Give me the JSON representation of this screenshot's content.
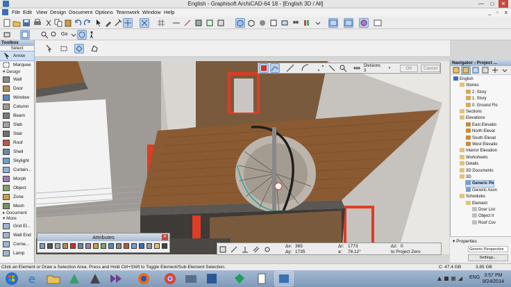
{
  "window": {
    "title": "English - Graphisoft ArchiCAD-64 18 - [English 3D / All]",
    "minimize_glyph": "—",
    "maximize_glyph": "□",
    "close_glyph": "✕",
    "mdi_min": "_",
    "mdi_restore": "▫",
    "mdi_close": "x"
  },
  "menu": [
    "File",
    "Edit",
    "View",
    "Design",
    "Document",
    "Options",
    "Teamwork",
    "Window",
    "Help"
  ],
  "toolbar": {
    "go_label": "Go"
  },
  "toolbox": {
    "title": "Toolbox",
    "select_section": "Select",
    "select_tools": [
      "Arrow",
      "Marquee"
    ],
    "design_section": "Design",
    "design_tools": [
      "Wall",
      "Door",
      "Window",
      "Column",
      "Beam",
      "Slab",
      "Stair",
      "Roof",
      "Shell",
      "Skylight",
      "Curtain...",
      "Morph",
      "Object",
      "Zone",
      "Mesh"
    ],
    "document_section": "Document",
    "more_section": "More",
    "more_tools": [
      "Grid El...",
      "Wall End",
      "Corne...",
      "Lamp"
    ]
  },
  "infobox": {
    "divisions_label": "Divisions",
    "divisions_value": "3",
    "ok_label": "OK",
    "cancel_label": "Cancel"
  },
  "navigator": {
    "title": "Navigator - Project ...",
    "tree": [
      {
        "label": "English",
        "depth": 0,
        "icon": "project-icon"
      },
      {
        "label": "Stories",
        "depth": 1,
        "icon": "folder-icon"
      },
      {
        "label": "2. Story",
        "depth": 2,
        "icon": "story-icon"
      },
      {
        "label": "1. Story",
        "depth": 2,
        "icon": "story-icon"
      },
      {
        "label": "0. Ground Flo",
        "depth": 2,
        "icon": "story-icon"
      },
      {
        "label": "Sections",
        "depth": 1,
        "icon": "folder-icon"
      },
      {
        "label": "Elevations",
        "depth": 1,
        "icon": "folder-icon"
      },
      {
        "label": "East Elevatio",
        "depth": 2,
        "icon": "elevation-icon"
      },
      {
        "label": "North Elevat",
        "depth": 2,
        "icon": "elevation-icon"
      },
      {
        "label": "South Elevat",
        "depth": 2,
        "icon": "elevation-icon"
      },
      {
        "label": "West Elevatio",
        "depth": 2,
        "icon": "elevation-icon"
      },
      {
        "label": "Interior Elevation",
        "depth": 1,
        "icon": "folder-icon"
      },
      {
        "label": "Worksheets",
        "depth": 1,
        "icon": "folder-icon"
      },
      {
        "label": "Details",
        "depth": 1,
        "icon": "folder-icon"
      },
      {
        "label": "3D Documents",
        "depth": 1,
        "icon": "folder-icon"
      },
      {
        "label": "3D",
        "depth": 1,
        "icon": "folder-icon"
      },
      {
        "label": "Generic Pe",
        "depth": 2,
        "icon": "3d-icon",
        "selected": true
      },
      {
        "label": "Generic Axon",
        "depth": 2,
        "icon": "3d-icon"
      },
      {
        "label": "Schedules",
        "depth": 1,
        "icon": "folder-icon"
      },
      {
        "label": "Element",
        "depth": 2,
        "icon": "folder-icon"
      },
      {
        "label": "Door List",
        "depth": 3,
        "icon": "list-icon"
      },
      {
        "label": "Object Ir",
        "depth": 3,
        "icon": "list-icon"
      },
      {
        "label": "Roof Cov",
        "depth": 3,
        "icon": "list-icon"
      }
    ]
  },
  "properties": {
    "title": "Properties",
    "view_name": "Generic Perspective",
    "settings_label": "Settings..."
  },
  "attributes": {
    "title": "Attributes"
  },
  "coordinates": {
    "dx_label": "Δx:",
    "dx": "365",
    "dy_label": "Δy:",
    "dy": "1735",
    "dr_label": "Δr:",
    "dr": "1773",
    "a_label": "a:",
    "a": "78.12°",
    "dz_label": "Δz:",
    "dz": "0",
    "ref_label": "to Project Zero"
  },
  "status": {
    "message": "Click an Element or Draw a Selection Area. Press and Hold Ctrl+Shift to Toggle Element/Sub-Element Selection.",
    "disk": "C: 47.4 GB",
    "memory": "3.85 GB"
  },
  "taskbar": {
    "language": "ENG",
    "time": "3:57 PM",
    "date": "9/24/2014"
  },
  "colors": {
    "accent": "#3c6fb4",
    "selection": "#b9d0ea",
    "frame_red": "#e03b24",
    "floor_wood": "#8a5a32"
  }
}
